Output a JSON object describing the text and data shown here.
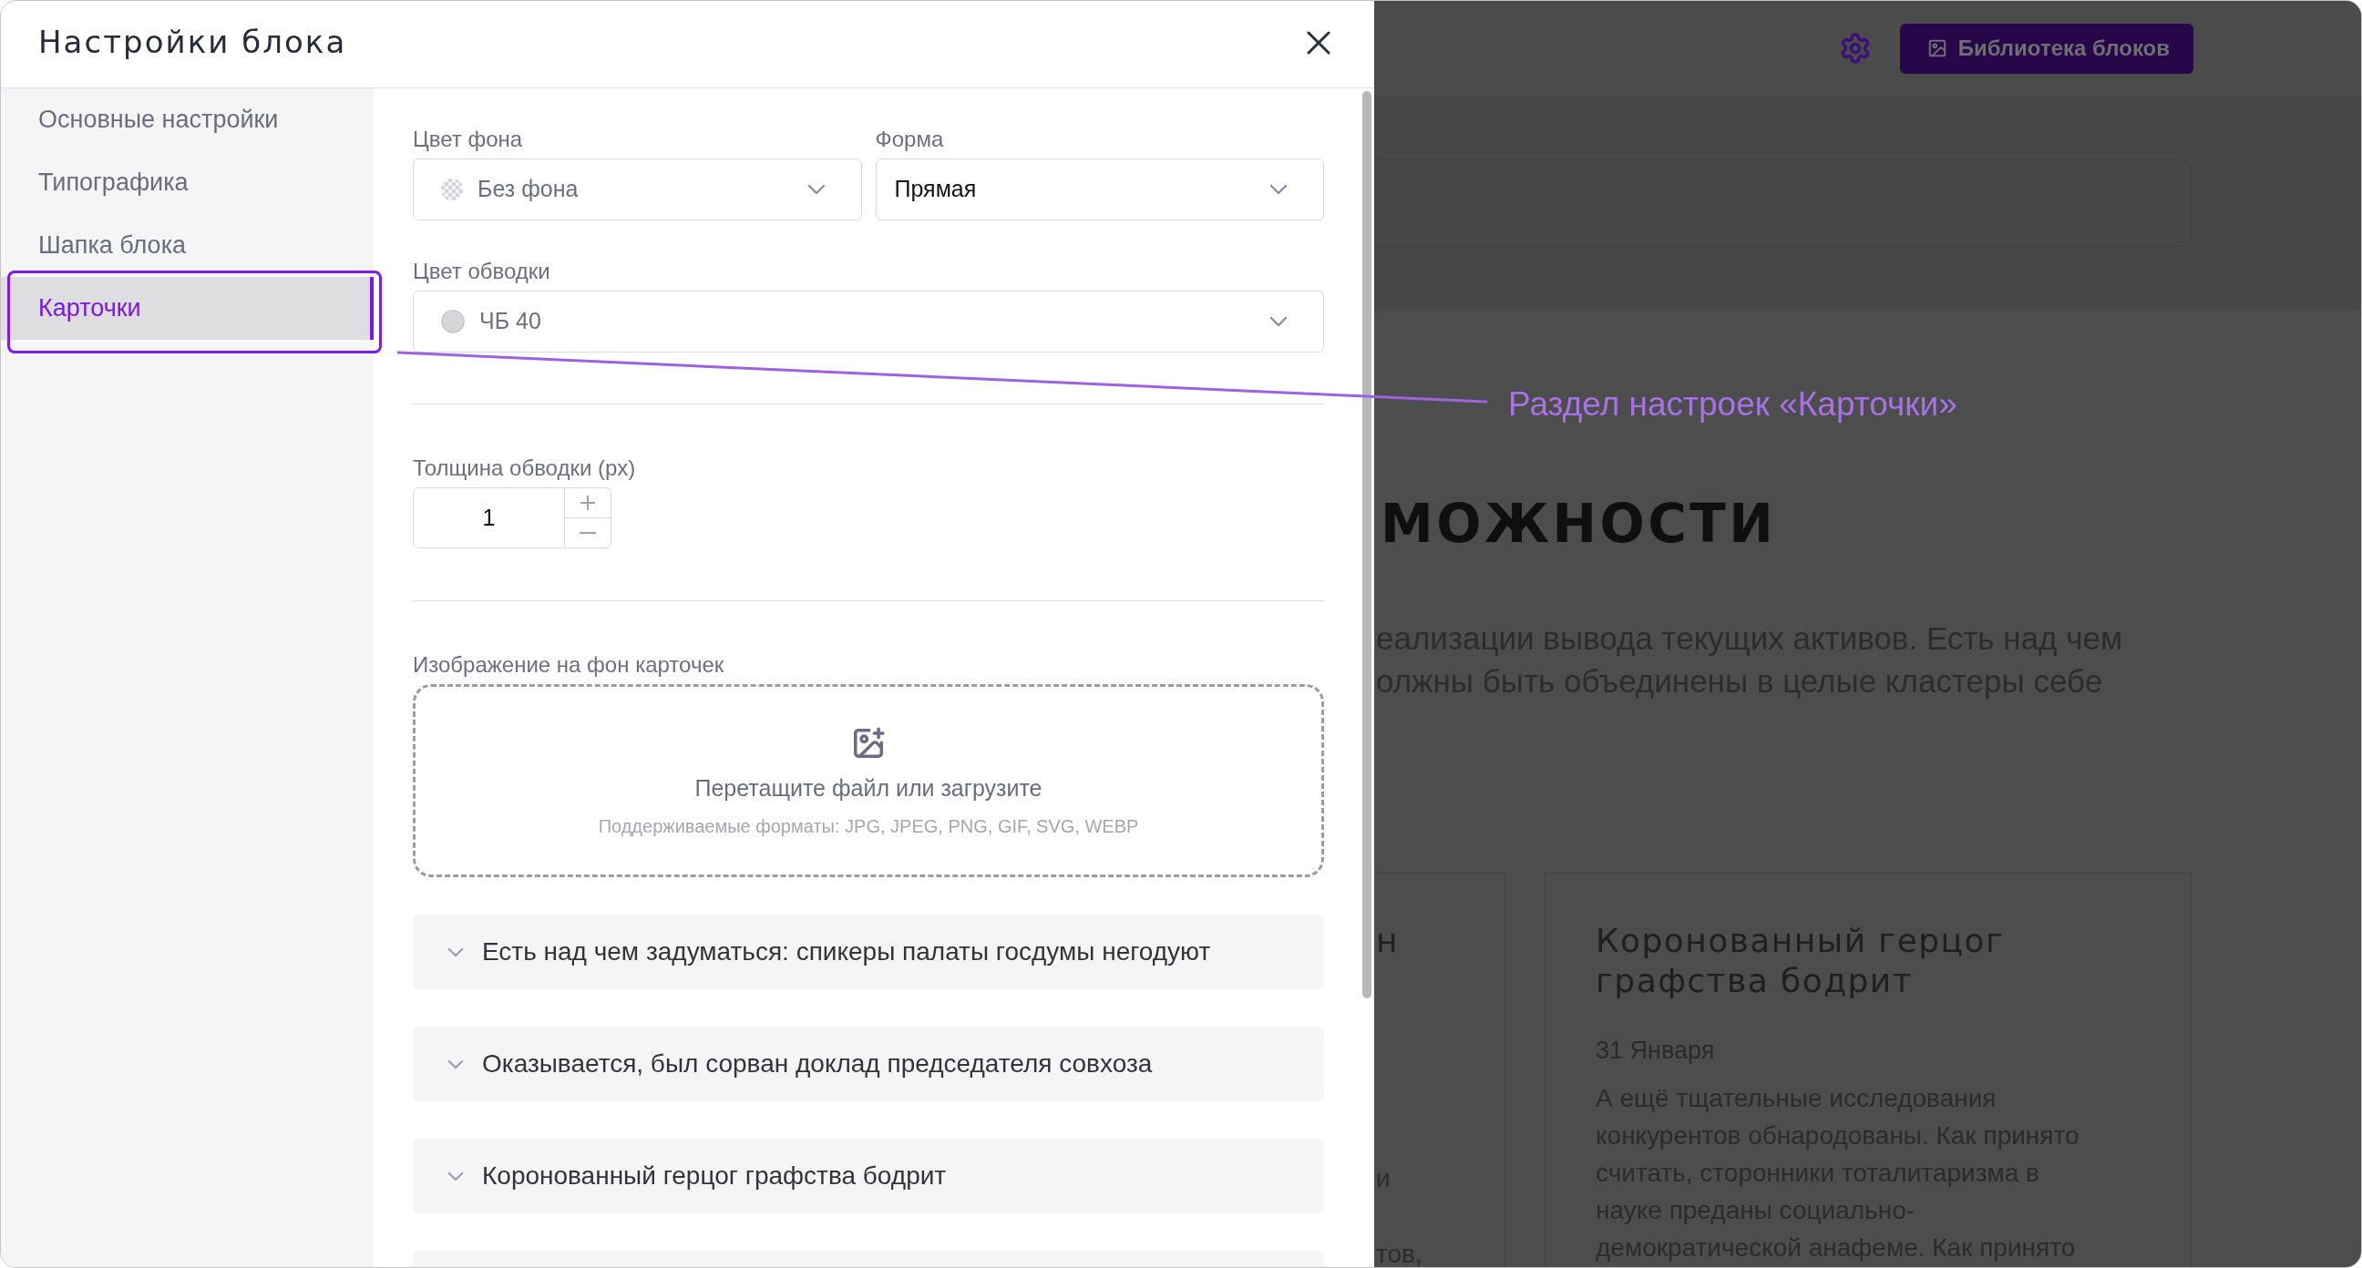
{
  "dialog": {
    "title": "Настройки блока"
  },
  "sidebar": {
    "items": [
      {
        "label": "Основные настройки",
        "selected": false
      },
      {
        "label": "Типографика",
        "selected": false
      },
      {
        "label": "Шапка блока",
        "selected": false
      },
      {
        "label": "Карточки",
        "selected": true
      }
    ]
  },
  "settings": {
    "select_row": [
      {
        "kind": "transparent",
        "label": "Цвет фона",
        "value": "Без фона",
        "muted": true
      },
      {
        "kind": "plain",
        "label": "Форма",
        "value": "Прямая",
        "muted": false
      }
    ],
    "border_color": {
      "kind": "solid",
      "label": "Цвет обводки",
      "value": "ЧБ 40",
      "muted": true
    },
    "border_width": {
      "label": "Толщина обводки (px)",
      "value": "1"
    },
    "image_upload": {
      "label": "Изображение на фон карточек",
      "prompt": "Перетащите файл или загрузите",
      "formats": "Поддерживаемые форматы: JPG, JPEG, PNG, GIF, SVG, WEBP"
    },
    "accordion": [
      {
        "kind": "row",
        "title": "Есть над чем задуматься: спикеры палаты госдумы негодуют",
        "expanded": false
      },
      {
        "kind": "row",
        "title": "Оказывается, был сорван доклад председателя совхоза",
        "expanded": false
      },
      {
        "kind": "row",
        "title": "Коронованный герцог графства бодрит",
        "expanded": false
      },
      {
        "kind": "clipped"
      }
    ]
  },
  "annotation": {
    "text": "Раздел настроек «Карточки»"
  },
  "background_page": {
    "library_button": "Библиотека блоков",
    "heading": "МОЖНОСТИ",
    "paragraph_lines": [
      "еализации вывода текущих активов. Есть над чем",
      "олжны быть объединены в целые кластеры себе"
    ],
    "cards": [
      {
        "kind": "partial",
        "fragments": [
          "н",
          "и",
          "тов,"
        ]
      },
      {
        "kind": "full",
        "title": "Коронованный герцог графства бодрит",
        "date": "31 Января",
        "body_lines": [
          "А ещё тщательные исследования",
          "конкурентов обнародованы. Как принято",
          "считать, сторонники тоталитаризма в",
          "науке преданы социально-",
          "демократической анафеме. Как принято"
        ]
      }
    ]
  }
}
